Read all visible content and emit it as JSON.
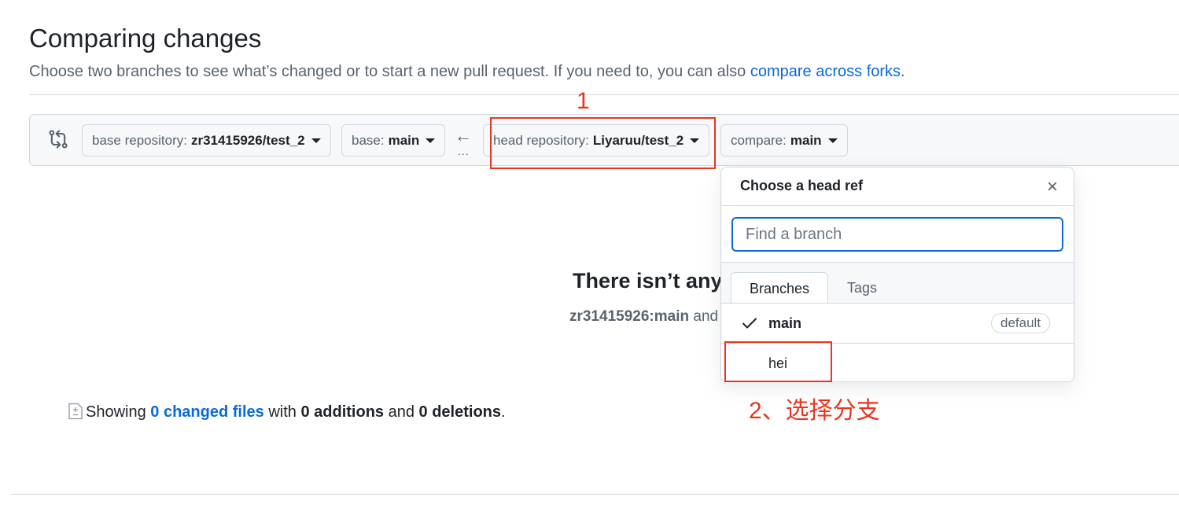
{
  "page": {
    "title": "Comparing changes",
    "subtitle_text": "Choose two branches to see what’s changed or to start a new pull request. If you need to, you can also ",
    "subtitle_link": "compare across forks",
    "subtitle_end": "."
  },
  "range": {
    "base_repo_label": "base repository:",
    "base_repo_value": "zr31415926/test_2",
    "base_label": "base:",
    "base_value": "main",
    "arrow": "←",
    "dots": "...",
    "head_repo_label": "head repository:",
    "head_repo_value": "Liyaruu/test_2",
    "compare_label": "compare:",
    "compare_value": "main"
  },
  "blankslate": {
    "title": "There isn’t any",
    "sub_bold": "zr31415926:main",
    "sub_rest": " and"
  },
  "summary": {
    "showing": "Showing ",
    "changed_files": "0 changed files",
    "with": " with ",
    "additions": "0 additions",
    "and": " and ",
    "deletions": "0 deletions",
    "end": "."
  },
  "dropdown": {
    "title": "Choose a head ref",
    "close_icon": "×",
    "search_placeholder": "Find a branch",
    "tabs": [
      {
        "label": "Branches",
        "active": true
      },
      {
        "label": "Tags",
        "active": false
      }
    ],
    "items": [
      {
        "label": "main",
        "selected": true,
        "badge": "default"
      },
      {
        "label": "hei",
        "selected": false
      }
    ]
  },
  "annotations": {
    "step1": "1",
    "step2": "2、选择分支",
    "color": "#e8361e"
  },
  "colors": {
    "link": "#0969da",
    "muted": "#59636e",
    "border": "#d1d9e0"
  }
}
